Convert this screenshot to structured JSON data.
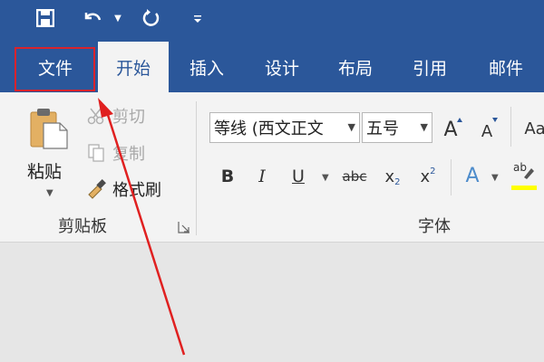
{
  "quick_access": {
    "save_icon": "save-icon",
    "undo_icon": "undo-icon",
    "undo_dropdown_icon": "chevron-down-icon",
    "redo_icon": "redo-icon",
    "customize_icon": "customize-qat-icon"
  },
  "tabs": [
    {
      "label": "文件"
    },
    {
      "label": "开始"
    },
    {
      "label": "插入"
    },
    {
      "label": "设计"
    },
    {
      "label": "布局"
    },
    {
      "label": "引用"
    },
    {
      "label": "邮件"
    }
  ],
  "clipboard": {
    "paste_label": "粘贴",
    "cut_label": "剪切",
    "copy_label": "复制",
    "format_painter_label": "格式刷",
    "group_label": "剪贴板"
  },
  "font": {
    "font_name": "等线 (西文正文",
    "font_size": "五号",
    "grow_label": "A",
    "shrink_label": "A",
    "bold_label": "B",
    "italic_label": "I",
    "underline_label": "U",
    "strike_label": "abc",
    "subscript_label": "x",
    "subscript_mark": "2",
    "superscript_label": "x",
    "superscript_mark": "2",
    "effects_label": "A",
    "highlight_label": "ab",
    "change_case_label": "Aa",
    "group_label": "字体"
  },
  "colors": {
    "title_bar": "#2b579a",
    "ribbon": "#f3f3f3",
    "highlight_box": "#d9232c",
    "annotation_arrow": "#e02020",
    "text_highlight": "#ffff00"
  }
}
